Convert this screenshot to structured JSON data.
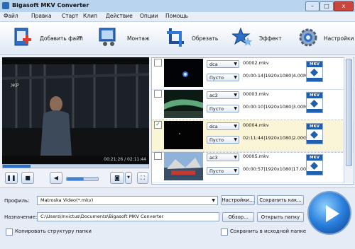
{
  "window": {
    "title": "Bigasoft MKV Converter",
    "minimize": "–",
    "maximize": "□",
    "close": "x"
  },
  "menu": [
    "Файл",
    "Правка",
    "Старт",
    "Клип",
    "Действие",
    "Опции",
    "Помощь"
  ],
  "toolbar": {
    "add_file": "Добавить файл",
    "montage": "Монтаж",
    "crop": "Обрезать",
    "effect": "Эффект",
    "settings": "Настройки"
  },
  "player": {
    "time": "00:21:26 / 02:11:44",
    "progress_fraction": 0.19,
    "volume_fraction": 0.55
  },
  "files": [
    {
      "checked": false,
      "name": "00002.mkv",
      "info": "00:00:14|1920x1080|4.00MB",
      "audio": "dca",
      "subtitle": "Пусто",
      "selected": false
    },
    {
      "checked": false,
      "name": "00003.mkv",
      "info": "00:00:10|1920x1080|3.00MB",
      "audio": "ac3",
      "subtitle": "Пусто",
      "selected": false
    },
    {
      "checked": true,
      "name": "00004.mkv",
      "info": "02:11:44|1920x1080|2.00GB",
      "audio": "dca",
      "subtitle": "Пусто",
      "selected": true
    },
    {
      "checked": false,
      "name": "00005.mkv",
      "info": "00:00:57|1920x1080|17.00MB",
      "audio": "ac3",
      "subtitle": "Пусто",
      "selected": false
    }
  ],
  "format_badge": {
    "top": "MKV",
    "bottom": "MATROSKA"
  },
  "bottom": {
    "profile_label": "Профиль:",
    "profile_value": "Matroska Video(*.mkv)",
    "settings_button": "Настройки...",
    "save_as_button": "Сохранить как...",
    "destination_label": "Назначение:",
    "destination_value": "C:\\Users\\Invictus\\Documents\\Bigasoft MKV Converter",
    "browse_button": "Обзор...",
    "open_folder_button": "Открыть папку",
    "copy_structure_label": "Копировать структуру папки",
    "save_source_label": "Сохранить в исходной папке"
  }
}
